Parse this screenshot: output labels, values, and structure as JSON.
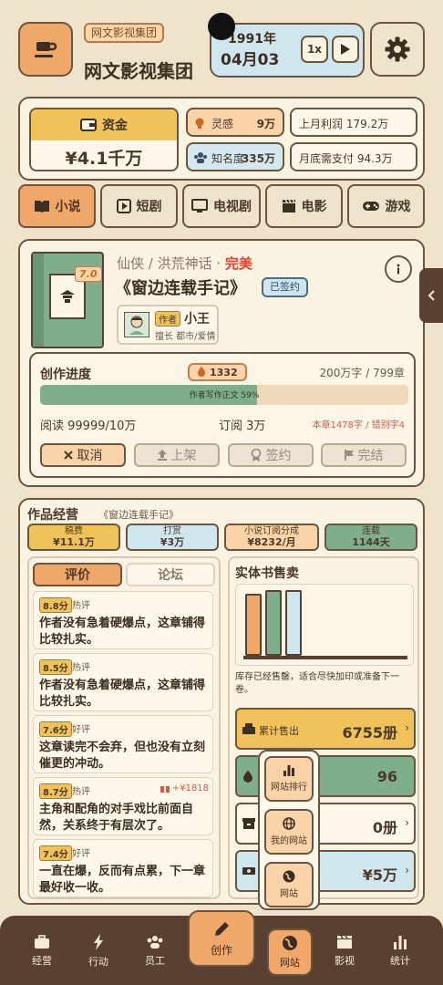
{
  "header": {
    "company_tag": "网文影视集团",
    "company_name": "网文影视集团",
    "date_year": "1991年",
    "date_day": "04月03",
    "speed": "1x"
  },
  "stats": {
    "funds_label": "资金",
    "funds_value": "¥4.1千万",
    "inspiration_label": "灵感",
    "inspiration_value": "9万",
    "fame_label": "知名度",
    "fame_value": "335万",
    "profit_label": "上月利润",
    "profit_value": "179.2万",
    "payable_label": "月底需支付",
    "payable_value": "94.3万"
  },
  "categories": [
    "小说",
    "短剧",
    "电视剧",
    "电影",
    "游戏"
  ],
  "novel": {
    "score": "7.0",
    "genre": "仙侠 / 洪荒神话 · ",
    "quality": "完美",
    "title": "《窗边连载手记》",
    "signed": "已签约",
    "author_tag": "作者",
    "author_name": "小王",
    "author_specialty": "擅长 都市/爱情",
    "progress_title": "创作进度",
    "progress_badge": "1332",
    "progress_words": "200万字 / 799章",
    "progress_bar_text": "作者写作正文 59%",
    "progress_ratio": 0.59,
    "reads": "阅读 99999/10万",
    "subs": "订阅 3万",
    "typos": "本章1478字 / 错别字4",
    "buttons": [
      "取消",
      "上架",
      "签约",
      "完结"
    ]
  },
  "works": {
    "title": "作品经营",
    "subtitle": "《窗边连载手记》",
    "metrics": [
      {
        "label": "稿费",
        "value": "¥11.1万"
      },
      {
        "label": "打赏",
        "value": "¥3万"
      },
      {
        "label": "小说订阅分成",
        "value": "¥8232/月"
      },
      {
        "label": "连载",
        "value": "1144天"
      }
    ],
    "tabs": [
      "评价",
      "论坛"
    ],
    "reviews": [
      {
        "score": "8.8分",
        "type": "热评",
        "text": "作者没有急着硬爆点，这章铺得比较扎实。",
        "gift": ""
      },
      {
        "score": "8.5分",
        "type": "热评",
        "text": "作者没有急着硬爆点，这章铺得比较扎实。",
        "gift": ""
      },
      {
        "score": "7.6分",
        "type": "好评",
        "text": "这章读完不会弃，但也没有立刻催更的冲动。",
        "gift": ""
      },
      {
        "score": "8.7分",
        "type": "热评",
        "text": "主角和配角的对手戏比前面自然，关系终于有层次了。",
        "gift": "+¥1818"
      },
      {
        "score": "7.4分",
        "type": "好评",
        "text": "一直在爆，反而有点累，下一章最好收一收。",
        "gift": ""
      }
    ],
    "sales_title": "实体书售卖",
    "stock_note": "库存已经售罄，适合尽快加印或准备下一卷。",
    "sold_label": "累计售出",
    "sold_value": "6755册",
    "green_value": "96",
    "zero_value": "0册",
    "money_value": "¥5万"
  },
  "popup": [
    "网站排行",
    "我的网站",
    "网站"
  ],
  "nav": [
    "经营",
    "行动",
    "员工",
    "创作",
    "网站",
    "影视",
    "统计"
  ],
  "colors": {
    "accent": "#efa76a",
    "gold": "#f0c35a",
    "green": "#7fae8a",
    "blue": "#cfe6ef",
    "brown": "#5a4030"
  }
}
